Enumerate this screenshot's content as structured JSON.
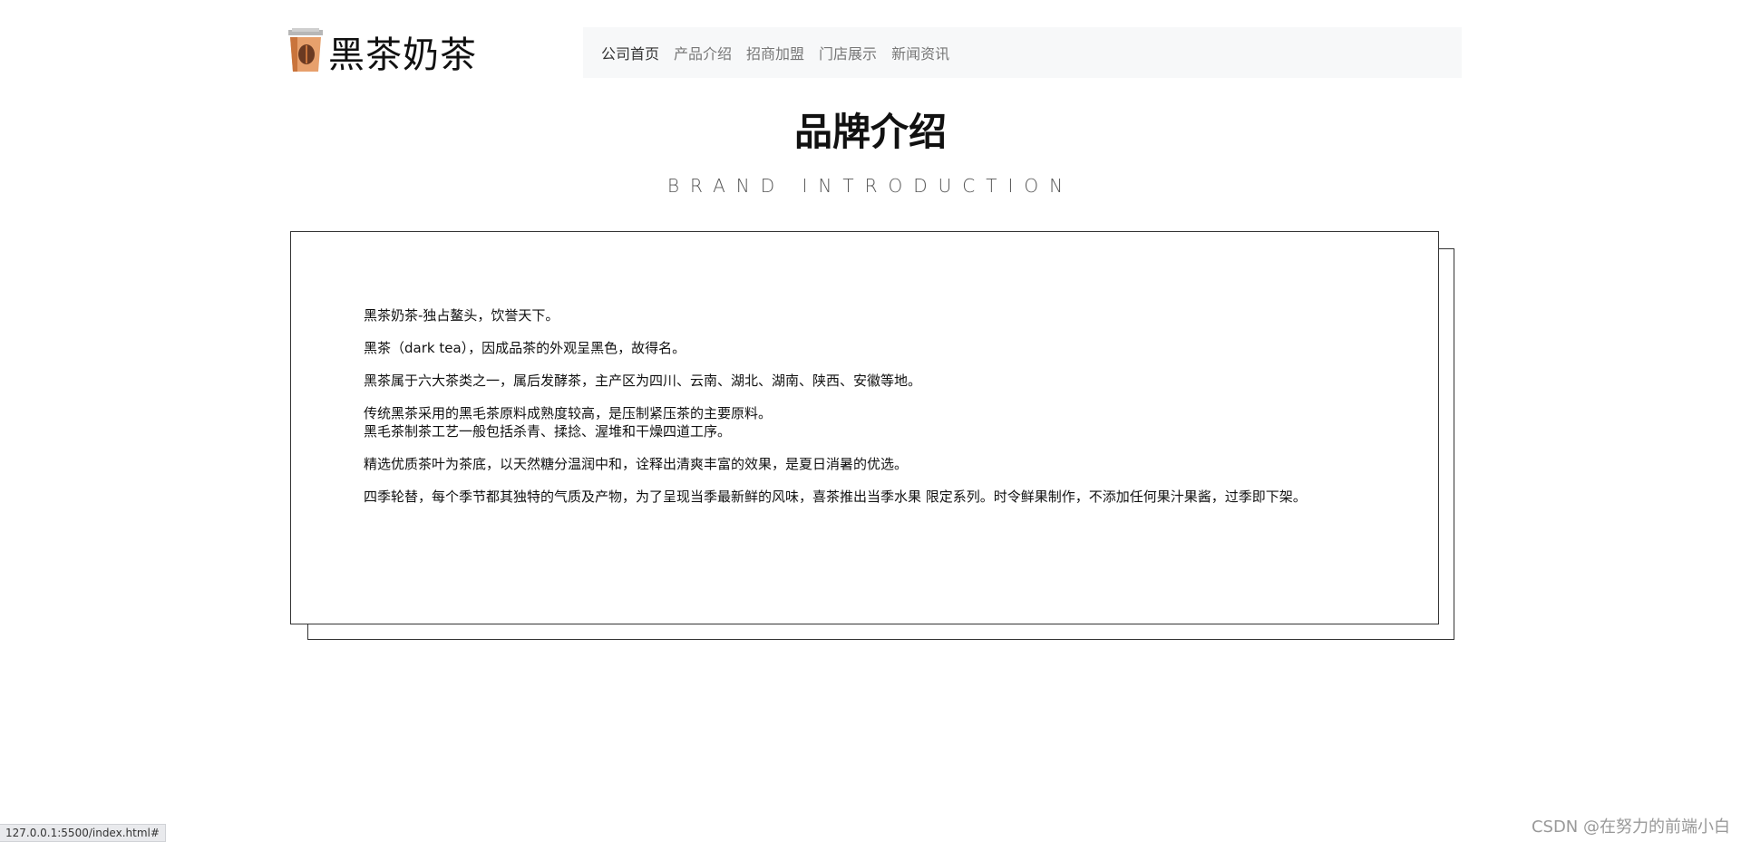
{
  "brand": {
    "name": "黑茶奶茶",
    "icon": "milk-tea-cup-icon"
  },
  "nav": {
    "items": [
      {
        "label": "公司首页"
      },
      {
        "label": "产品介绍"
      },
      {
        "label": "招商加盟"
      },
      {
        "label": "门店展示"
      },
      {
        "label": "新闻资讯"
      }
    ],
    "active_index": 0
  },
  "section": {
    "title": "品牌介绍",
    "subtitle": "BRAND INTRODUCTION"
  },
  "intro": {
    "paragraphs": [
      [
        "黑茶奶茶-独占鳌头，饮誉天下。"
      ],
      [
        "黑茶（dark tea），因成品茶的外观呈黑色，故得名。"
      ],
      [
        "黑茶属于六大茶类之一，属后发酵茶，主产区为四川、云南、湖北、湖南、陕西、安徽等地。"
      ],
      [
        "传统黑茶采用的黑毛茶原料成熟度较高，是压制紧压茶的主要原料。",
        "黑毛茶制茶工艺一般包括杀青、揉捻、渥堆和干燥四道工序。"
      ],
      [
        "精选优质茶叶为茶底，以天然糖分温润中和，诠释出清爽丰富的效果，是夏日消暑的优选。"
      ],
      [
        "四季轮替，每个季节都其独特的气质及产物，为了呈现当季最新鲜的风味，喜茶推出当季水果 限定系列。时令鲜果制作，不添加任何果汁果酱，过季即下架。"
      ]
    ]
  },
  "status_bar": {
    "url": "127.0.0.1:5500/index.html#"
  },
  "watermark": "CSDN @在努力的前端小白",
  "colors": {
    "nav_bg": "#f7f8f9",
    "border": "#333333",
    "logo_orange": "#d9844a"
  }
}
